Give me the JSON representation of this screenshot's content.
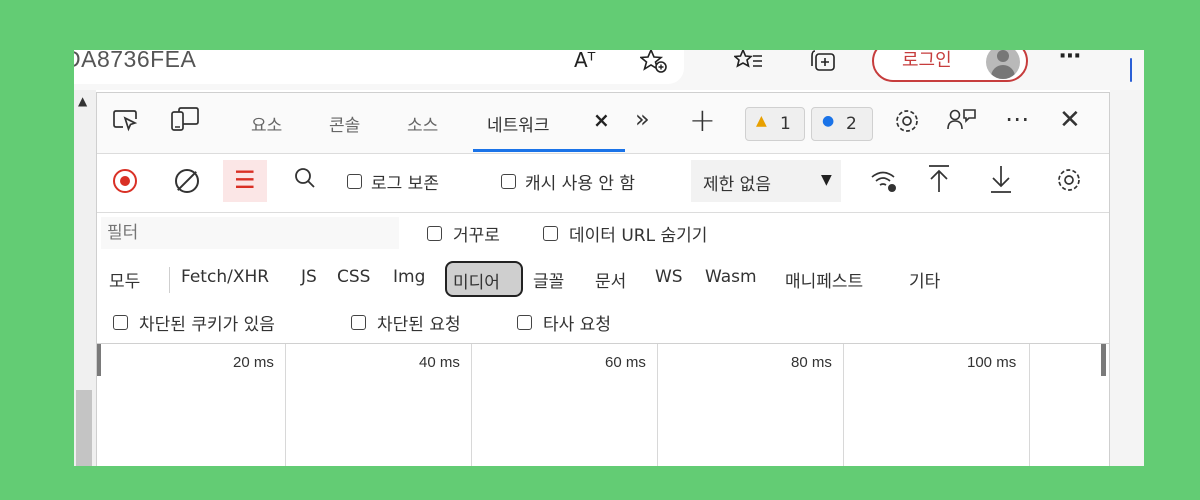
{
  "browser": {
    "url_fragment": "DA8736FEA",
    "read_aloud_icon": "Aᵀ",
    "login_label": "로그인"
  },
  "devtools": {
    "tabs": [
      {
        "label": "요소"
      },
      {
        "label": "콘솔"
      },
      {
        "label": "소스"
      },
      {
        "label": "네트워크",
        "active": true
      }
    ],
    "more_tabs": "»",
    "add_tab": "+",
    "warnings_count": "1",
    "messages_count": "2",
    "close": "✕",
    "overflow": "⋯"
  },
  "network_toolbar": {
    "preserve_log": "로그 보존",
    "disable_cache": "캐시 사용 안 함",
    "throttling": "제한 없음"
  },
  "filter": {
    "placeholder": "필터",
    "invert": "거꾸로",
    "hide_data_urls": "데이터 URL 숨기기"
  },
  "type_filters": [
    "모두",
    "Fetch/XHR",
    "JS",
    "CSS",
    "Img",
    "미디어",
    "글꼴",
    "문서",
    "WS",
    "Wasm",
    "매니페스트",
    "기타"
  ],
  "selected_type": "미디어",
  "request_filters": {
    "blocked_cookies": "차단된 쿠키가 있음",
    "blocked_requests": "차단된 요청",
    "third_party": "타사 요청"
  },
  "timeline": {
    "ticks": [
      "20 ms",
      "40 ms",
      "60 ms",
      "80 ms",
      "100 ms"
    ]
  },
  "colors": {
    "background": "#63cc74",
    "record": "#d93025",
    "active_tab": "#1a73e8",
    "login_border": "#c63c3c"
  }
}
